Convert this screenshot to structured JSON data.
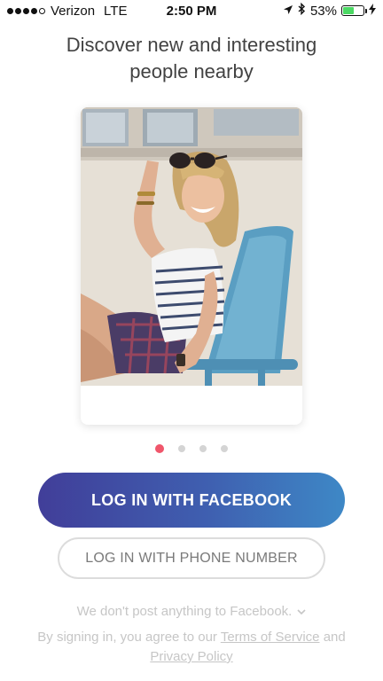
{
  "status_bar": {
    "carrier": "Verizon",
    "network": "LTE",
    "time": "2:50 PM",
    "battery_percent": "53%",
    "battery_level": 0.53,
    "signal_bars": 4
  },
  "headline": {
    "line1": "Discover new and interesting",
    "line2": "people nearby"
  },
  "carousel": {
    "page_count": 4,
    "active_index": 0
  },
  "buttons": {
    "facebook_label": "LOG IN WITH FACEBOOK",
    "phone_label": "LOG IN WITH PHONE NUMBER"
  },
  "footer": {
    "note": "We don't post anything to Facebook.",
    "legal_prefix": "By signing in, you agree to our",
    "terms_link": "Terms of Service",
    "legal_and": "and",
    "privacy_link": "Privacy Policy"
  },
  "colors": {
    "accent_pink": "#f0566b",
    "facebook_gradient_start": "#413e99",
    "facebook_gradient_end": "#3e88c6"
  }
}
